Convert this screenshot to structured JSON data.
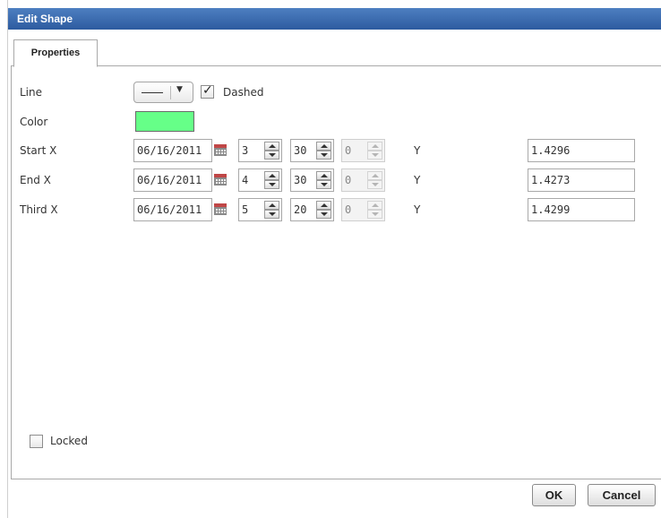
{
  "dialog": {
    "title": "Edit Shape",
    "tabs": [
      {
        "label": "Properties",
        "active": true
      }
    ],
    "ok_label": "OK",
    "cancel_label": "Cancel"
  },
  "form": {
    "line": {
      "label": "Line",
      "style": "solid",
      "dashed_label": "Dashed",
      "dashed_checked": true
    },
    "color": {
      "label": "Color",
      "value": "#66ff88"
    },
    "rows": [
      {
        "label": "Start X",
        "date": "06/16/2011",
        "hour": "3",
        "minute": "30",
        "second": "0",
        "y_label": "Y",
        "y_value": "1.4296"
      },
      {
        "label": "End X",
        "date": "06/16/2011",
        "hour": "4",
        "minute": "30",
        "second": "0",
        "y_label": "Y",
        "y_value": "1.4273"
      },
      {
        "label": "Third X",
        "date": "06/16/2011",
        "hour": "5",
        "minute": "20",
        "second": "0",
        "y_label": "Y",
        "y_value": "1.4299"
      }
    ],
    "locked": {
      "label": "Locked",
      "checked": false
    }
  },
  "colors": {
    "title_bar": "#3b6cb0",
    "swatch": "#66ff88"
  },
  "icons": {
    "calendar": "calendar-icon",
    "dropdown": "chevron-down-icon",
    "spin_up": "spin-up-icon",
    "spin_down": "spin-down-icon",
    "check": "checkmark-icon"
  }
}
